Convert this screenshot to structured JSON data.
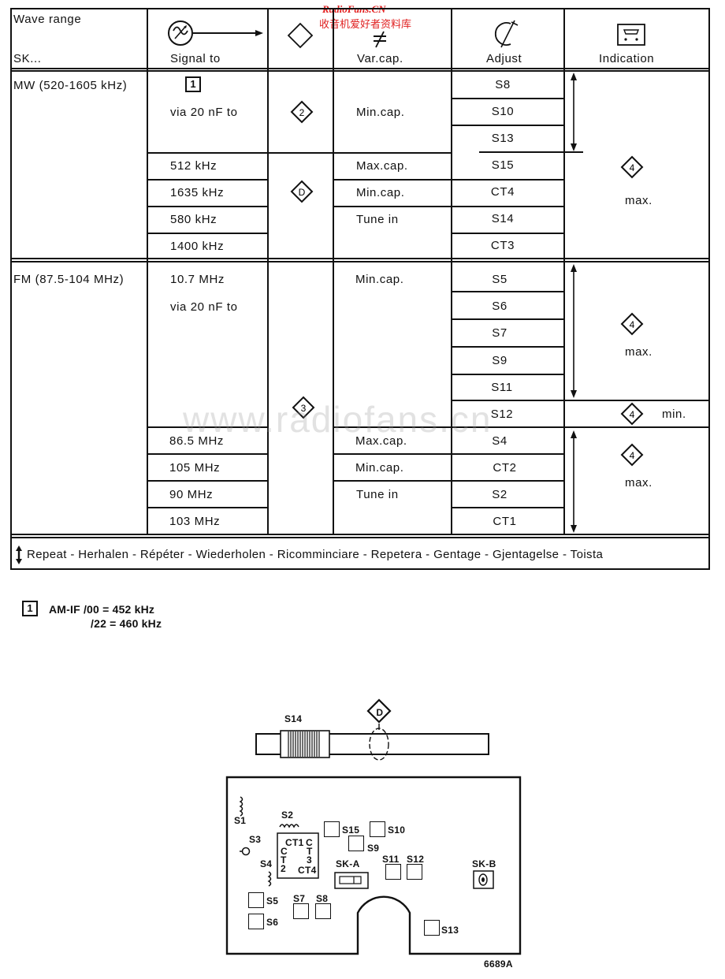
{
  "watermark": {
    "top_en": "RadioFans.CN",
    "top_cn": "收音机爱好者资料库",
    "center": "www.radiofans.cn"
  },
  "table": {
    "headers": {
      "wave_range": "Wave range",
      "sk": "SK...",
      "signal_to": "Signal to",
      "var_cap": "Var.cap.",
      "adjust": "Adjust",
      "indication": "Indication",
      "signal_icon": "signal-generator-icon",
      "diamond_icon": "measure-point-icon",
      "varcap_icon": "variable-capacitor-icon",
      "adjust_icon": "trimmer-icon",
      "indication_icon": "meter-icon"
    },
    "mw": {
      "range": "MW (520-1605 kHz)",
      "ref_box": "1",
      "via": "via 20 nF to",
      "point_a": "2",
      "point_b": "D",
      "signals": [
        "512 kHz",
        "1635 kHz",
        "580 kHz",
        "1400 kHz"
      ],
      "varcap": [
        "Min.cap.",
        "Max.cap.",
        "Min.cap.",
        "Tune in"
      ],
      "adjust": [
        "S8",
        "S10",
        "S13",
        "S15",
        "CT4",
        "S14",
        "CT3"
      ],
      "indication_point": "4",
      "indication": "max."
    },
    "fm": {
      "range": "FM (87.5-104 MHz)",
      "signal_if": "10.7 MHz",
      "via": "via 20 nF to",
      "point": "3",
      "signals": [
        "86.5 MHz",
        "105 MHz",
        "90 MHz",
        "103 MHz"
      ],
      "varcap": [
        "Min.cap.",
        "Max.cap.",
        "Min.cap.",
        "Tune in"
      ],
      "adjust": [
        "S5",
        "S6",
        "S7",
        "S9",
        "S11",
        "S12",
        "S4",
        "CT2",
        "S2",
        "CT1"
      ],
      "indication_point": "4",
      "indication_max": "max.",
      "indication_min": "min.",
      "indication_max2": "max."
    },
    "repeat_note": "Repeat - Herhalen - Répéter - Wiederholen - Ricomminciare - Repetera - Gentage - Gjentagelse - Toista"
  },
  "footnote": {
    "ref": "1",
    "line1": "AM-IF /00 = 452 kHz",
    "line2": "/22 = 460 kHz"
  },
  "diagram": {
    "rod_label": "S14",
    "rod_point": "D",
    "labels": {
      "s1": "S1",
      "s2": "S2",
      "s3": "S3",
      "s4": "S4",
      "s5": "S5",
      "s6": "S6",
      "s7": "S7",
      "s8": "S8",
      "s9": "S9",
      "s10": "S10",
      "s11": "S11",
      "s12": "S12",
      "s13": "S13",
      "s15": "S15",
      "ska": "SK-A",
      "skb": "SK-B",
      "ct1": "CT1",
      "ct4": "CT4",
      "ct2_c": "C",
      "ct2_t": "T",
      "ct2_n": "2",
      "ct3_c": "C",
      "ct3_t": "T",
      "ct3_n": "3"
    },
    "drawing_number": "6689A"
  }
}
